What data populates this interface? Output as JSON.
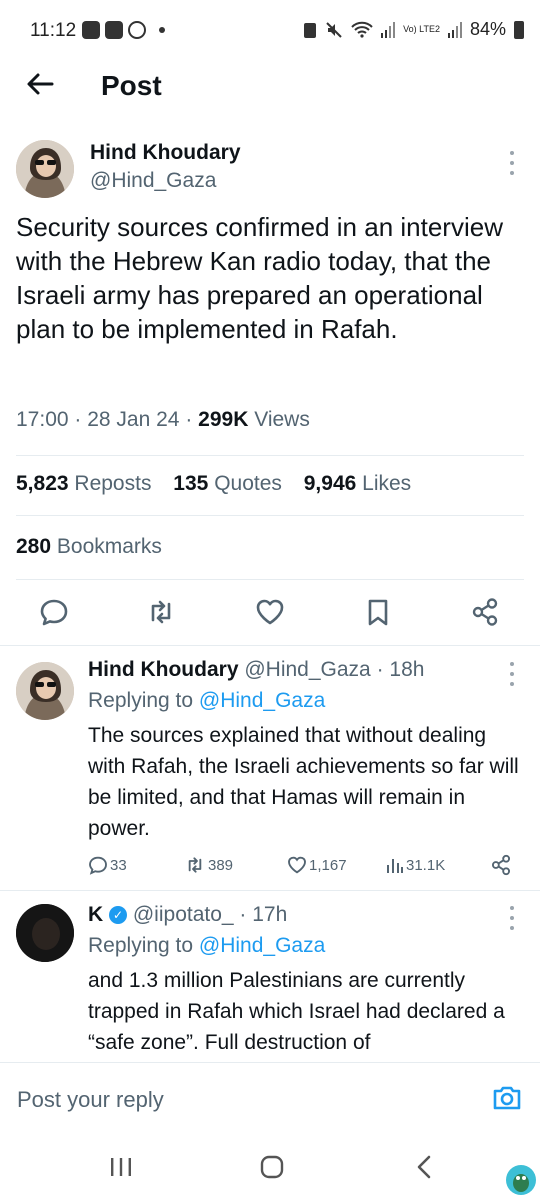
{
  "status_bar": {
    "time": "11:12",
    "network": "Vo) LTE2",
    "battery": "84%"
  },
  "header": {
    "title": "Post"
  },
  "post": {
    "author_name": "Hind Khoudary",
    "author_handle": "@Hind_Gaza",
    "text": "Security sources confirmed in an interview with the Hebrew Kan radio today, that the Israeli army has prepared an operational plan to be implemented in Rafah.",
    "time": "17:00",
    "date": "28 Jan 24",
    "views_count": "299K",
    "views_label": "Views",
    "reposts_count": "5,823",
    "reposts_label": "Reposts",
    "quotes_count": "135",
    "quotes_label": "Quotes",
    "likes_count": "9,946",
    "likes_label": "Likes",
    "bookmarks_count": "280",
    "bookmarks_label": "Bookmarks"
  },
  "replies": [
    {
      "name": "Hind Khoudary",
      "handle": "@Hind_Gaza",
      "age": "18h",
      "replying_label": "Replying to",
      "replying_to": "@Hind_Gaza",
      "text": "The sources explained that without dealing with Rafah, the Israeli achievements so far will be limited, and that Hamas will remain in power.",
      "replies": "33",
      "reposts": "389",
      "likes": "1,167",
      "views": "31.1K"
    },
    {
      "name": "K",
      "handle": "@iipotato_",
      "age": "17h",
      "replying_label": "Replying to",
      "replying_to": "@Hind_Gaza",
      "text": "and 1.3 million Palestinians are currently trapped in Rafah which Israel had declared a “safe zone”. Full destruction of"
    }
  ],
  "reply_box": {
    "placeholder": "Post your reply"
  },
  "colors": {
    "accent": "#1d9bf0",
    "text_primary": "#0f1419",
    "text_secondary": "#536471",
    "divider": "#e6ecf0"
  }
}
